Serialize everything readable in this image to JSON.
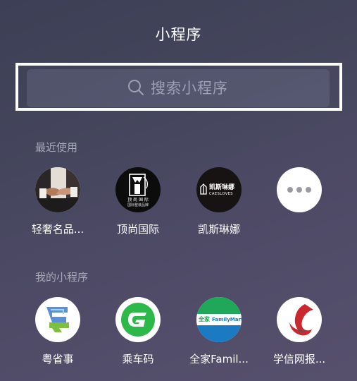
{
  "header": {
    "title": "小程序"
  },
  "search": {
    "placeholder": "搜索小程序"
  },
  "recent": {
    "label": "最近使用",
    "items": [
      {
        "label": "轻奢名品...",
        "icon": "handshake-photo-icon"
      },
      {
        "label": "顶尚国际",
        "icon": "dingshang-logo-icon",
        "logo_line1": "顶 尚 国 际",
        "logo_line2": "国际整装品牌"
      },
      {
        "label": "凯斯琳娜",
        "icon": "caesloves-logo-icon",
        "logo_line1": "凯斯琳娜",
        "logo_line2": "CAESLOVES"
      },
      {
        "label": "",
        "icon": "more-dots-icon"
      }
    ]
  },
  "mine": {
    "label": "我的小程序",
    "items": [
      {
        "label": "粤省事",
        "icon": "yueshengshi-logo-icon"
      },
      {
        "label": "乘车码",
        "icon": "chengchema-logo-icon"
      },
      {
        "label": "全家Famil...",
        "icon": "familymart-logo-icon",
        "logo_left": "全家",
        "logo_right": "FamilyMart"
      },
      {
        "label": "学信网报...",
        "icon": "xuexin-logo-icon"
      }
    ]
  },
  "colors": {
    "background": "#45465d",
    "familymart_green": "#1fa85a",
    "familymart_blue": "#1a7ac2",
    "chengchema_green": "#2db84a",
    "xuexin_red": "#c8282e"
  }
}
